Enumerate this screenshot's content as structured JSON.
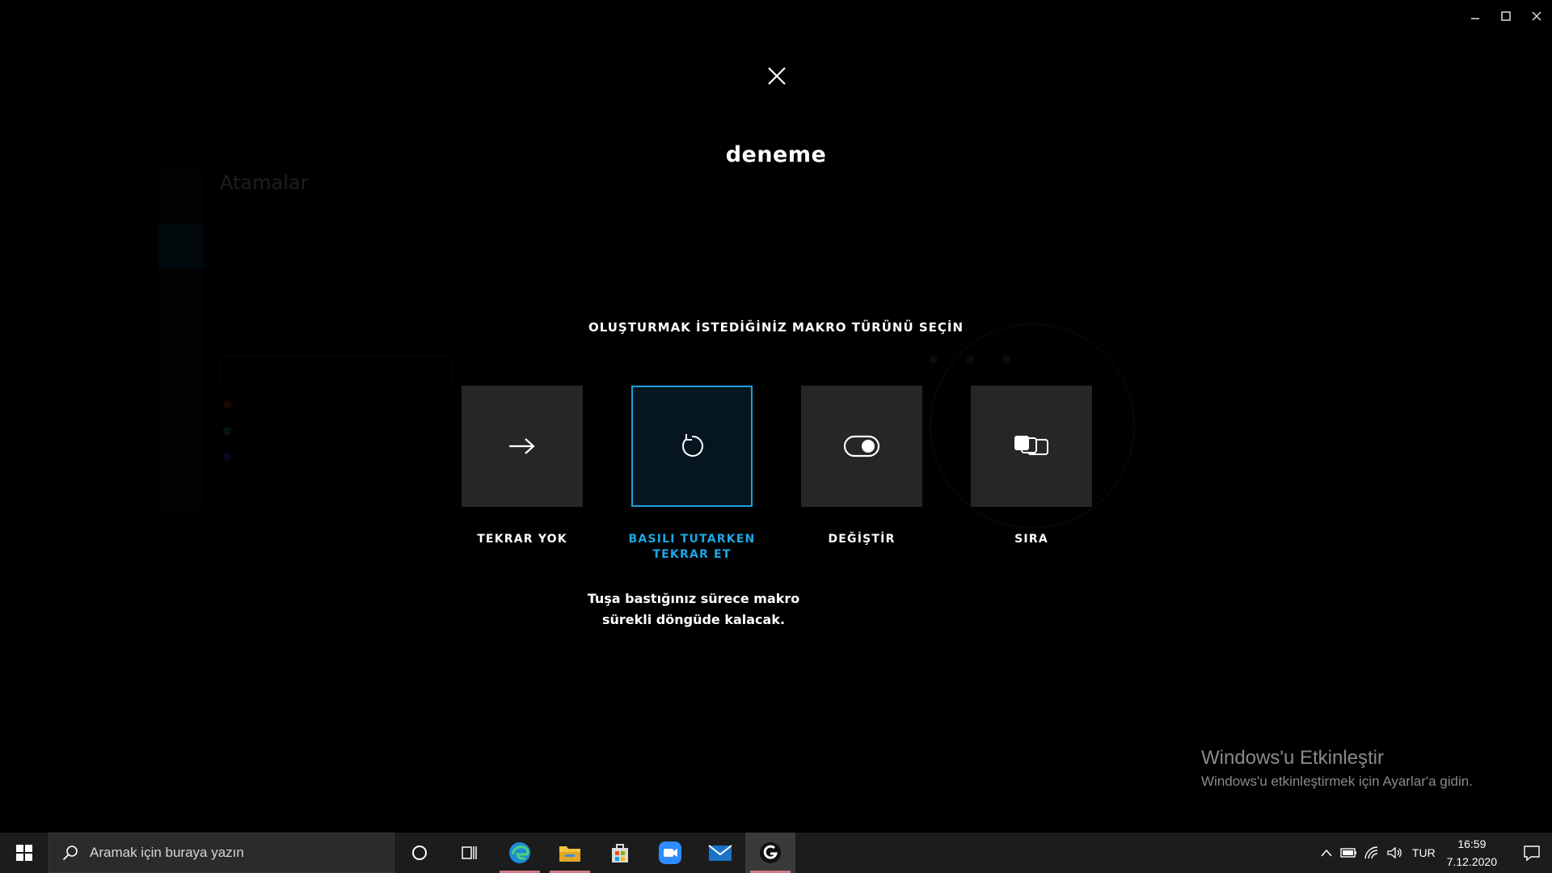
{
  "dialog": {
    "title": "deneme",
    "subtitle": "OLUŞTURMAK İSTEDİĞİNİZ MAKRO TÜRÜNÜ SEÇİN",
    "options": [
      {
        "label": "TEKRAR YOK",
        "icon": "arrow-right-icon",
        "selected": false
      },
      {
        "label": "BASILI TUTARKEN\nTEKRAR ET",
        "icon": "repeat-icon",
        "selected": true
      },
      {
        "label": "DEĞİŞTİR",
        "icon": "toggle-icon",
        "selected": false
      },
      {
        "label": "SIRA",
        "icon": "sequence-icon",
        "selected": false
      }
    ],
    "description": "Tuşa bastığınız sürece makro sürekli döngüde kalacak.",
    "accent_color": "#1ba7e6"
  },
  "background_app": {
    "title": "Atamalar"
  },
  "watermark": {
    "title": "Windows'u Etkinleştir",
    "subtitle": "Windows'u etkinleştirmek için Ayarlar'a gidin."
  },
  "taskbar": {
    "search_placeholder": "Aramak için buraya yazın",
    "apps": [
      "cortana-icon",
      "task-view-icon",
      "edge-icon",
      "file-explorer-icon",
      "store-icon",
      "zoom-icon",
      "mail-icon",
      "logitech-g-hub-icon"
    ],
    "language": "TUR",
    "time": "16:59",
    "date": "7.12.2020"
  }
}
